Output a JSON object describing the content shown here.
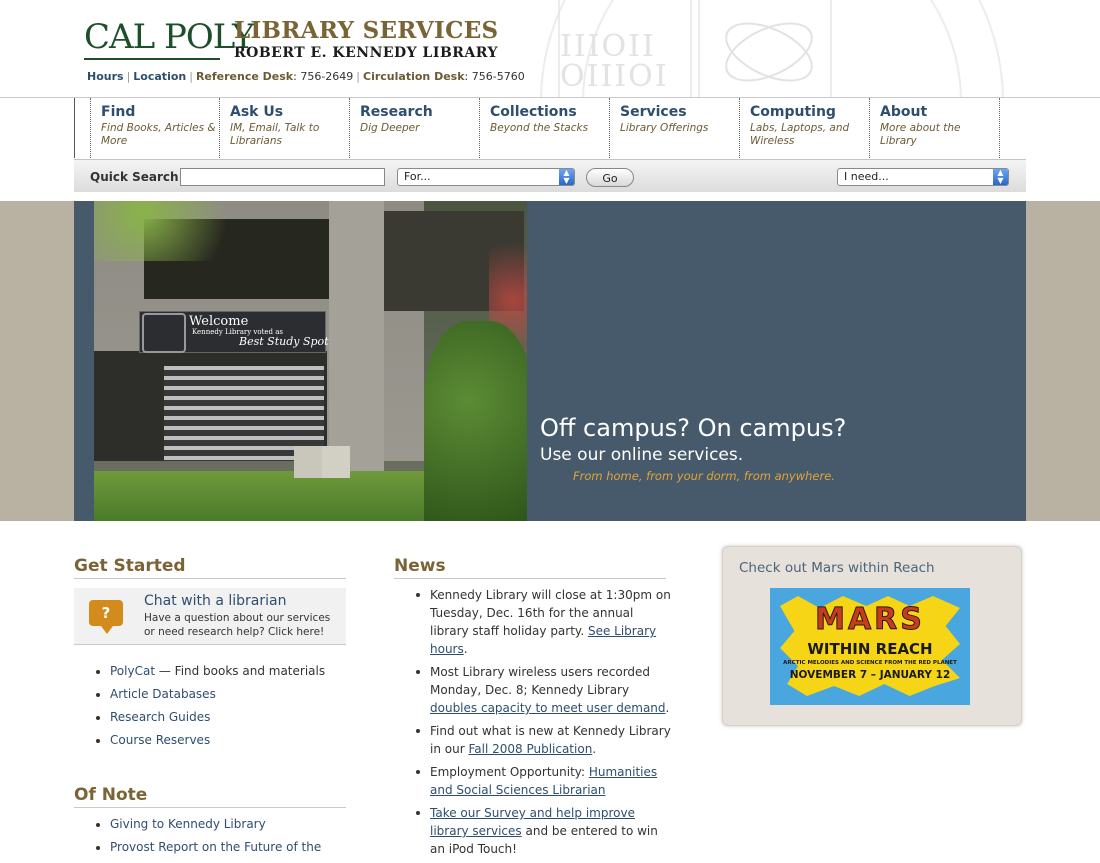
{
  "header": {
    "logo": "CAL POLY",
    "title": "LIBRARY SERVICES",
    "subtitle": "ROBERT E. KENNEDY LIBRARY",
    "quicklinks": {
      "hours": "Hours",
      "location": "Location",
      "reference_label": "Reference Desk",
      "reference_phone": ": 756-2649",
      "circulation_label": "Circulation Desk",
      "circulation_phone": ": 756-5760"
    },
    "seal_text": "IIIOII OIIIOI"
  },
  "nav": [
    {
      "title": "Find",
      "sub": "Find Books, Articles & More"
    },
    {
      "title": "Ask Us",
      "sub": "IM, Email, Talk to Librarians"
    },
    {
      "title": "Research",
      "sub": "Dig Deeper"
    },
    {
      "title": "Collections",
      "sub": "Beyond the Stacks"
    },
    {
      "title": "Services",
      "sub": "Library Offerings"
    },
    {
      "title": "Computing",
      "sub": "Labs, Laptops, and Wireless"
    },
    {
      "title": "About",
      "sub": "More about the Library"
    }
  ],
  "search": {
    "label": "Quick Search",
    "input_value": "",
    "for_select": "For...",
    "go_label": "Go",
    "need_select": "I need..."
  },
  "hero": {
    "sign_title": "Welcome",
    "sign_sub": "Kennedy Library voted as",
    "sign_big": "Best Study Spot",
    "headline": "Off campus? On campus?",
    "subhead": "Use our online services.",
    "tagline": "From home, from your dorm, from anywhere."
  },
  "get_started": {
    "heading": "Get Started",
    "chat_title": "Chat with a librarian",
    "chat_text": "Have a question about our services or need research help? Click here!",
    "chat_icon": "?",
    "links": [
      {
        "link": "PolyCat",
        "rest": " — Find books and materials"
      },
      {
        "link": "Article Databases",
        "rest": ""
      },
      {
        "link": "Research Guides",
        "rest": ""
      },
      {
        "link": "Course Reserves",
        "rest": ""
      }
    ]
  },
  "of_note": {
    "heading": "Of Note",
    "links": [
      {
        "link": "Giving to Kennedy Library"
      },
      {
        "link": "Provost Report on the Future of the"
      }
    ]
  },
  "news": {
    "heading": "News",
    "items": [
      {
        "pre": "Kennedy Library will close at 1:30pm on Tuesday, Dec. 16th for the annual library staff holiday party. ",
        "link": "See Library hours",
        "post": "."
      },
      {
        "pre": "Most Library wireless users recorded Monday, Dec. 8; Kennedy Library ",
        "link": "doubles capacity to meet user demand",
        "post": "."
      },
      {
        "pre": "Find out what is new at Kennedy Library in our ",
        "link": "Fall 2008 Publication",
        "post": "."
      },
      {
        "pre": "Employment Opportunity: ",
        "link": "Humanities and Social Sciences Librarian",
        "post": ""
      },
      {
        "pre": "",
        "link": "Take our Survey and help improve library services",
        "post": " and be entered to win an iPod Touch!"
      }
    ]
  },
  "feature": {
    "title": "Check out Mars within Reach",
    "mars_word": "MARS",
    "mars_within": "WITHIN REACH",
    "mars_tag": "ARCTIC MELODIES AND SCIENCE FROM THE RED PLANET",
    "mars_dates": "NOVEMBER 7 – JANUARY 12"
  }
}
